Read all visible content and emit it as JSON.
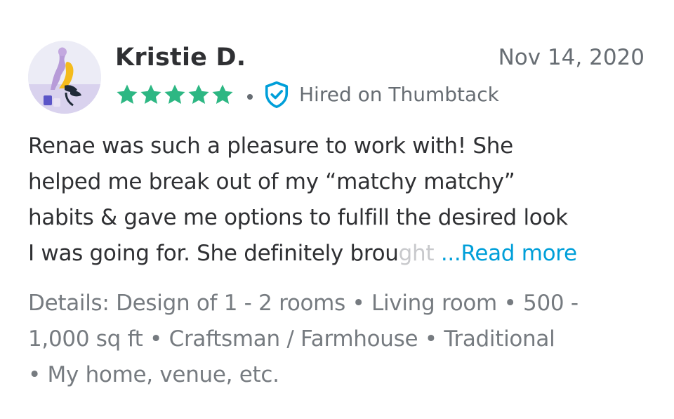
{
  "review": {
    "reviewer_name": "Kristie D.",
    "date": "Nov 14, 2020",
    "rating": 5,
    "rating_max": 5,
    "star_icon": "star-icon",
    "star_color": "#2db783",
    "separator": "•",
    "verified_icon": "shield-check-icon",
    "verified_color": "#009fd9",
    "hired_label": "Hired on Thumbtack",
    "body_lines": [
      "Renae was such a pleasure to work with! She",
      "helped me break out of my “matchy matchy”",
      "habits & gave me options to fulfill the desired look"
    ],
    "body_last_line_visible": "I was going for. She definitely brou",
    "body_last_line_faded": "ght ",
    "read_more_label": "...Read more",
    "read_more_color": "#009fd9",
    "details_lines": [
      "Details: Design of 1 - 2 rooms • Living room • 500 -",
      "1,000 sq ft • Craftsman / Farmhouse • Traditional",
      "• My home, venue, etc."
    ]
  }
}
